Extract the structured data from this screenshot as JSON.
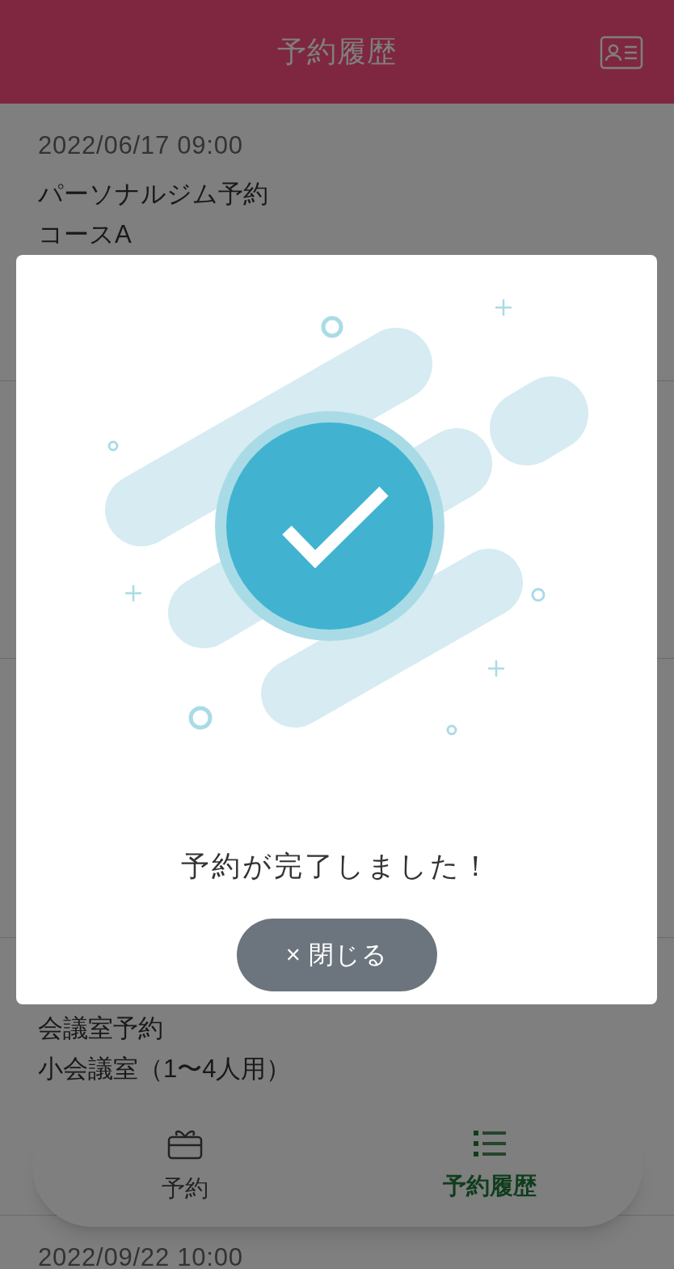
{
  "header": {
    "title": "予約履歴"
  },
  "reservations": [
    {
      "date": "2022/06/17 09:00",
      "title": "パーソナルジム予約",
      "detail": "コースA"
    },
    {
      "title": "会議室予約",
      "detail": "小会議室（1〜4人用）"
    },
    {
      "date": "2022/09/22 10:00"
    }
  ],
  "dialog": {
    "message": "予約が完了しました！",
    "close_button": "× 閉じる"
  },
  "bottom_nav": [
    {
      "label": "予約",
      "kind": "gift",
      "selected": false
    },
    {
      "label": "予約履歴",
      "kind": "list",
      "selected": true
    }
  ]
}
